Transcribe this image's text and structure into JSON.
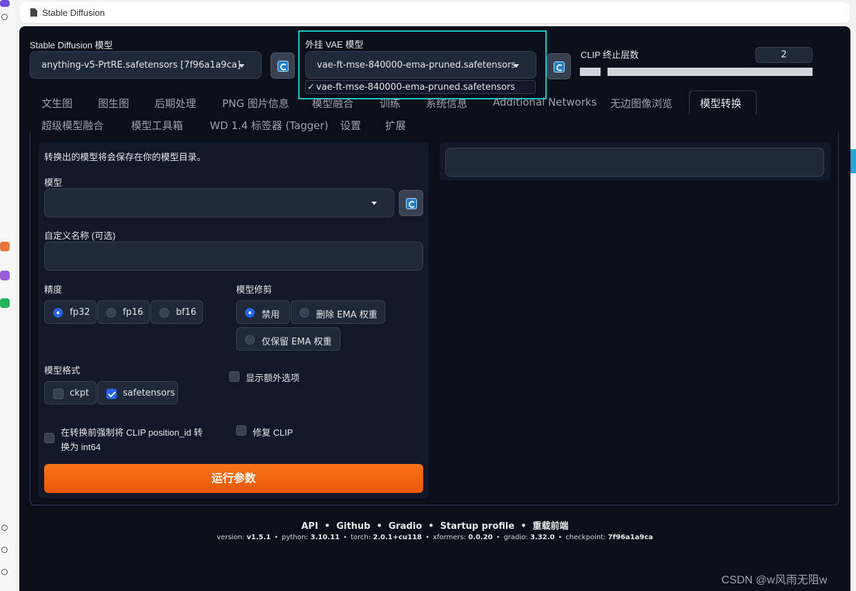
{
  "browser": {
    "tab_title": "Stable Diffusion"
  },
  "top": {
    "sd_model_label": "Stable Diffusion 模型",
    "sd_model_value": "anything-v5-PrtRE.safetensors [7f96a1a9ca]",
    "vae_label": "外挂 VAE 模型",
    "vae_value": "vae-ft-mse-840000-ema-pruned.safetensors",
    "vae_option": "vae-ft-mse-840000-ema-pruned.safetensors",
    "vae_option_check": "✓",
    "clip_label": "CLIP 终止层数",
    "clip_value": "2",
    "clip_slider_fraction": 0.09
  },
  "tabs_row1": [
    "文生图",
    "图生图",
    "后期处理",
    "PNG 图片信息",
    "模型融合",
    "训练",
    "系统信息",
    "Additional Networks",
    "无边图像浏览",
    "模型转换"
  ],
  "tabs_row2": [
    "超级模型融合",
    "模型工具箱",
    "WD 1.4 标签器 (Tagger)",
    "设置",
    "扩展"
  ],
  "active_tab": "模型转换",
  "converter": {
    "intro": "转换出的模型将会保存在你的模型目录。",
    "model_label": "模型",
    "model_value": "",
    "custom_name_label": "自定义名称 (可选)",
    "custom_name_value": "",
    "precision_label": "精度",
    "precision_options": [
      "fp32",
      "fp16",
      "bf16"
    ],
    "precision_selected": "fp32",
    "prune_label": "模型修剪",
    "prune_options": [
      "禁用",
      "删除 EMA 权重",
      "仅保留 EMA 权重"
    ],
    "prune_selected": "禁用",
    "format_label": "模型格式",
    "format_options": [
      "ckpt",
      "safetensors"
    ],
    "format_checked": [
      "safetensors"
    ],
    "show_extra_label": "显示额外选项",
    "force_clip_label_line1": "在转换前强制将 CLIP position_id 转",
    "force_clip_label_line2": "换为 int64",
    "fix_clip_label": "修复 CLIP",
    "run_label": "运行参数"
  },
  "footer": {
    "links": [
      "API",
      "Github",
      "Gradio",
      "Startup profile",
      "重载前端"
    ],
    "sep": "•",
    "meta": [
      {
        "key": "version: ",
        "val": "v1.5.1"
      },
      {
        "key": "python: ",
        "val": "3.10.11"
      },
      {
        "key": "torch: ",
        "val": "2.0.1+cu118"
      },
      {
        "key": "xformers: ",
        "val": "0.0.20"
      },
      {
        "key": "gradio: ",
        "val": "3.32.0"
      },
      {
        "key": "checkpoint: ",
        "val": "7f96a1a9ca"
      }
    ]
  },
  "watermark": "CSDN @w风雨无阻w",
  "colors": {
    "app_bg": "#0b0f19",
    "accent_blue": "#2563eb",
    "run_orange": "#ea580c",
    "highlight_cyan": "#1fc6c9"
  }
}
